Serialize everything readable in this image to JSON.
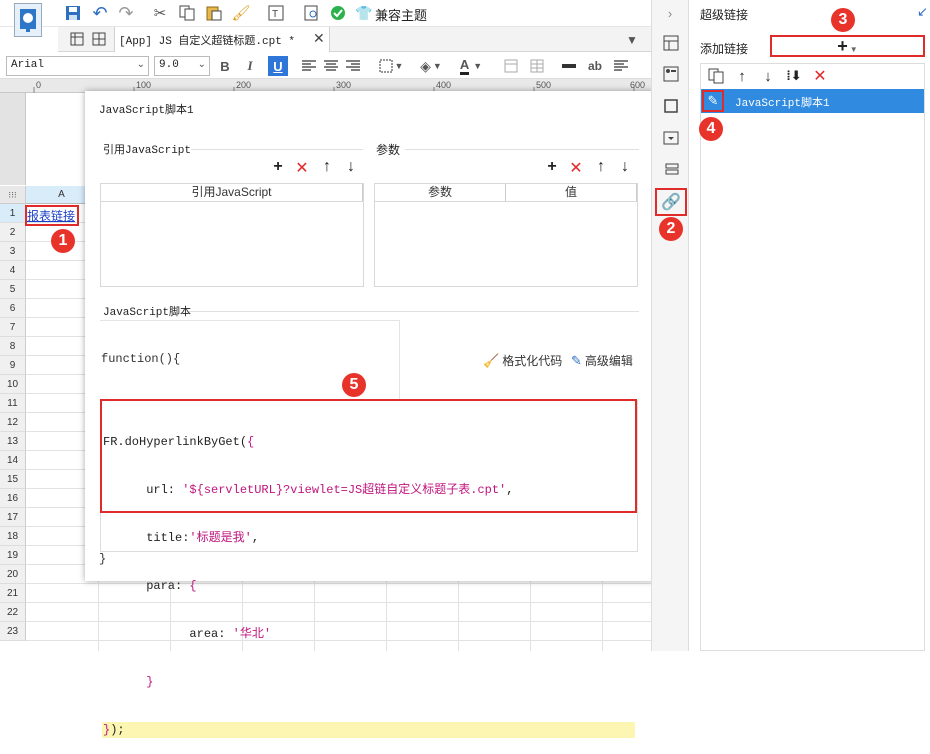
{
  "toolbar": {
    "compat_theme": "兼容主题"
  },
  "tab": {
    "label": "[App] JS 自定义超链标题.cpt *"
  },
  "format": {
    "font": "Arial",
    "size": "9.0",
    "bold": "B",
    "italic": "I",
    "underline": "U",
    "fontcolor": "A",
    "ab": "ab"
  },
  "ruler": {
    "ticks": [
      "0",
      "100",
      "200",
      "300",
      "400",
      "500",
      "600"
    ]
  },
  "sheet": {
    "col_a": "A",
    "cell_a1": "报表链接",
    "rows": [
      "1",
      "2",
      "3",
      "4",
      "5",
      "6",
      "7",
      "8",
      "9",
      "10",
      "11",
      "12",
      "13",
      "14",
      "15",
      "16",
      "17",
      "18",
      "19",
      "20",
      "21",
      "22",
      "23"
    ]
  },
  "dialog": {
    "title": "JavaScript脚本1",
    "ref_js_section": "引用JavaScript",
    "params_section": "参数",
    "ref_js_col": "引用JavaScript",
    "param_col": "参数",
    "value_col": "值",
    "script_section": "JavaScript脚本",
    "function_header": "function(){",
    "format_code": "格式化代码",
    "advanced_edit": "高级编辑",
    "closing": "}",
    "code": {
      "l1": "FR.doHyperlinkByGet(",
      "l1b": "{",
      "l2k": "      url: ",
      "l2v": "'${servletURL}?viewlet=JS超链自定义标题子表.cpt'",
      "l2e": ",",
      "l3k": "      title:",
      "l3v": "'标题是我'",
      "l3e": ",",
      "l4k": "      para: ",
      "l4v": "{",
      "l5k": "            area: ",
      "l5v": "'华北'",
      "l6": "      }",
      "l7a": "}",
      "l7b": ");"
    }
  },
  "panel": {
    "title": "超级链接",
    "add_link": "添加链接",
    "add_btn": "+",
    "item": "JavaScript脚本1"
  },
  "badges": [
    "1",
    "2",
    "3",
    "4",
    "5"
  ]
}
